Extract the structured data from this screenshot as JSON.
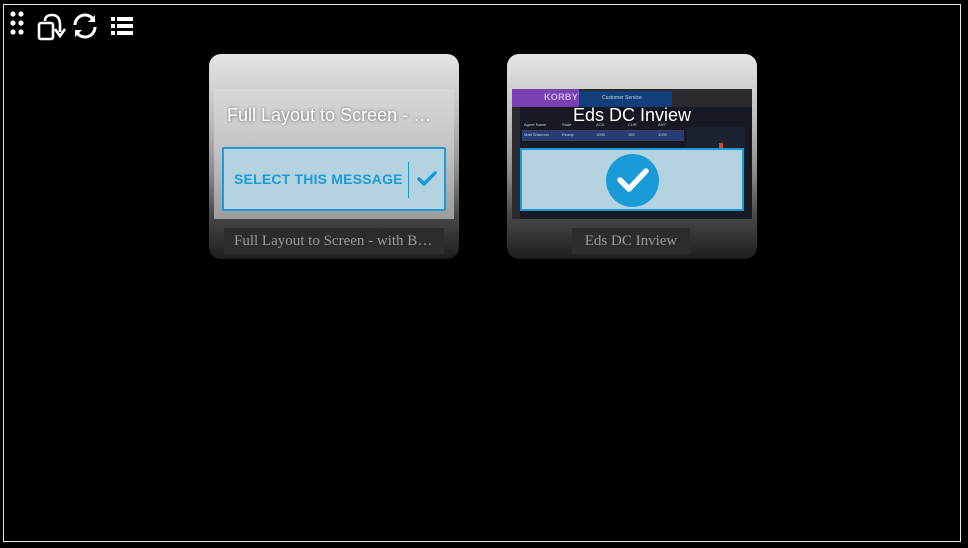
{
  "toolbar": {
    "drag_icon": "drag-handle-icon",
    "rotate_icon": "rotate-screen-icon",
    "refresh_icon": "refresh-icon",
    "list_icon": "list-view-icon"
  },
  "cards": [
    {
      "title": "Full Layout to Screen - with Blank Placeholders",
      "select_label": "SELECT THIS MESSAGE",
      "caption": "Full Layout to Screen - with Blank Placeholders",
      "selected": false
    },
    {
      "title": "Eds DC Inview",
      "caption": "Eds DC Inview",
      "selected": true,
      "preview": {
        "logo": "KORBYT",
        "header": "Customer Service",
        "columns": [
          "Agent Name",
          "State",
          "ACD",
          "CUR",
          "AHT"
        ],
        "rows": [
          [
            "Matt Shannon",
            "Ready",
            "1000",
            "150",
            "1000"
          ]
        ]
      }
    }
  ],
  "colors": {
    "background": "#000000",
    "accent": "#1a9bd7",
    "select_fill": "#b3d3e1"
  }
}
